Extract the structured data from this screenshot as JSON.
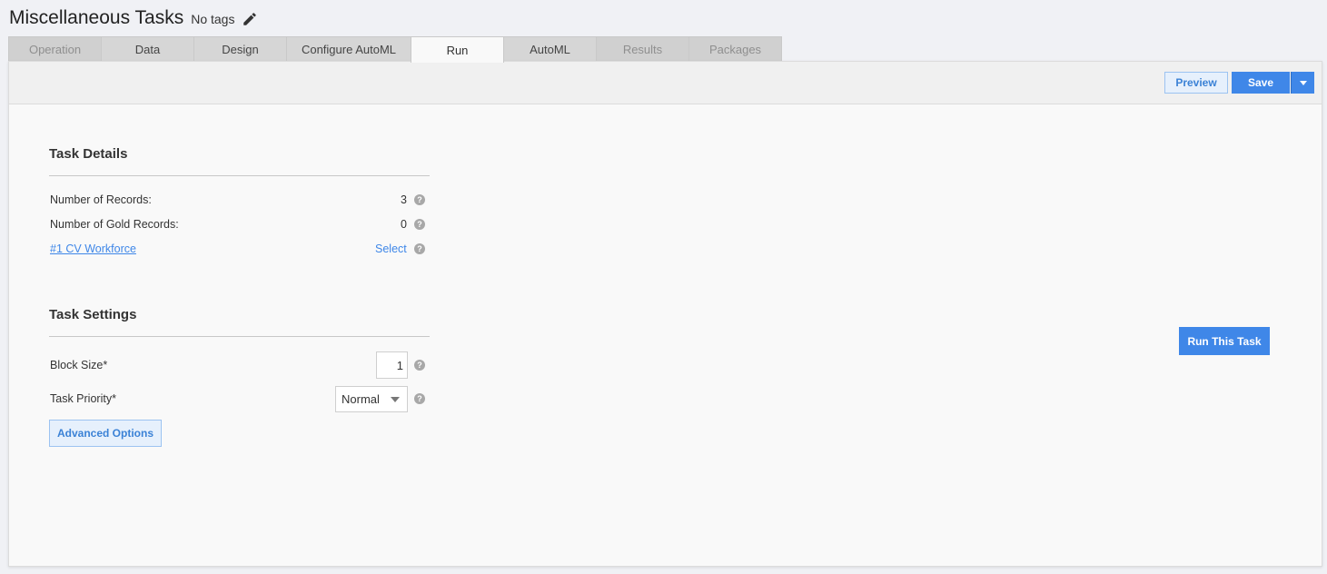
{
  "header": {
    "title": "Miscellaneous Tasks",
    "tags": "No tags"
  },
  "tabs": [
    {
      "label": "Operation",
      "state": "disabled"
    },
    {
      "label": "Data",
      "state": "normal"
    },
    {
      "label": "Design",
      "state": "normal"
    },
    {
      "label": "Configure AutoML",
      "state": "normal"
    },
    {
      "label": "Run",
      "state": "active"
    },
    {
      "label": "AutoML",
      "state": "normal"
    },
    {
      "label": "Results",
      "state": "disabled"
    },
    {
      "label": "Packages",
      "state": "disabled"
    }
  ],
  "toolbar": {
    "preview_label": "Preview",
    "save_label": "Save"
  },
  "task_details": {
    "title": "Task Details",
    "records_label": "Number of Records:",
    "records_value": "3",
    "gold_label": "Number of Gold Records:",
    "gold_value": "0",
    "workforce_link": "#1 CV Workforce",
    "select_link": "Select"
  },
  "task_settings": {
    "title": "Task Settings",
    "block_size_label": "Block Size*",
    "block_size_value": "1",
    "priority_label": "Task Priority*",
    "priority_value": "Normal",
    "advanced_label": "Advanced Options"
  },
  "run_button_label": "Run This Task",
  "help_glyph": "?",
  "colors": {
    "accent": "#3f87e8",
    "accent_light": "#e6f0fc",
    "tab_inactive": "#d6d6d6",
    "panel_bg": "#f9f9f9",
    "page_bg": "#f0f1f5"
  }
}
